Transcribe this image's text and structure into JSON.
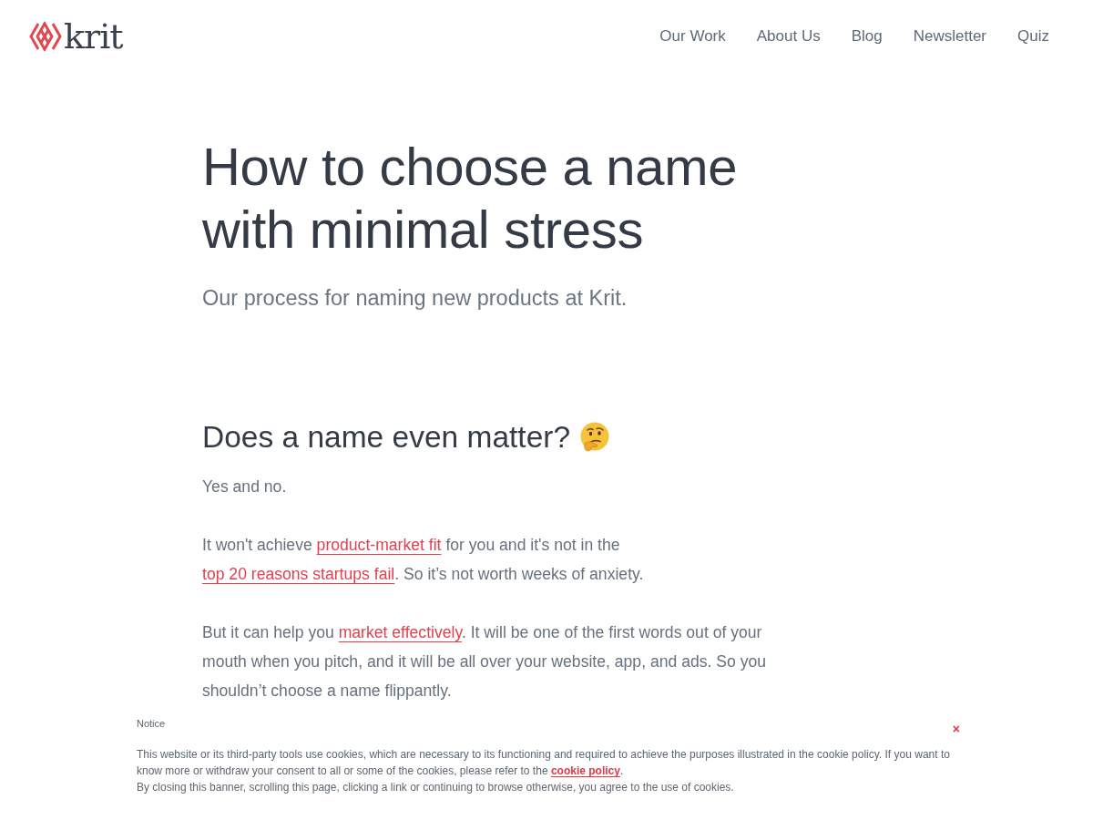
{
  "header": {
    "logo": {
      "text": "krit"
    },
    "nav": [
      {
        "label": "Our Work"
      },
      {
        "label": "About Us"
      },
      {
        "label": "Blog"
      },
      {
        "label": "Newsletter"
      },
      {
        "label": "Quiz"
      }
    ]
  },
  "article": {
    "title": "How to choose a name with minimal stress",
    "subtitle": "Our process for naming new products at Krit.",
    "sections": [
      {
        "heading": "Does a name even matter?",
        "paragraphs": [
          [
            {
              "kind": "text",
              "text": "Yes and no."
            }
          ],
          [
            {
              "kind": "text",
              "text": "It won't achieve "
            },
            {
              "kind": "link",
              "text": "product-market fit"
            },
            {
              "kind": "text",
              "text": " for you and it's not in the "
            },
            {
              "kind": "link",
              "text": "top 20 reasons startups fail"
            },
            {
              "kind": "text",
              "text": ". So it’s not worth weeks of anxiety."
            }
          ],
          [
            {
              "kind": "text",
              "text": "But it can help you "
            },
            {
              "kind": "link",
              "text": "market effectively"
            },
            {
              "kind": "text",
              "text": ". It will be one of the first words out of your mouth when you pitch, and it will be all over your website, app, and ads. So you shouldn’t choose a name flippantly."
            }
          ]
        ]
      }
    ]
  },
  "cookie_notice": {
    "title": "Notice",
    "close": "×",
    "paragraphs": [
      [
        {
          "kind": "text",
          "text": "This website or its third-party tools use cookies, which are necessary to its functioning and required to achieve the purposes illustrated in the cookie policy. If you want to know more or withdraw your consent to all or some of the cookies, please refer to the "
        },
        {
          "kind": "link",
          "text": "cookie policy"
        },
        {
          "kind": "text",
          "text": "."
        }
      ],
      [
        {
          "kind": "text",
          "text": "By closing this banner, scrolling this page, clicking a link or continuing to browse otherwise, you agree to the use of cookies."
        }
      ]
    ]
  }
}
